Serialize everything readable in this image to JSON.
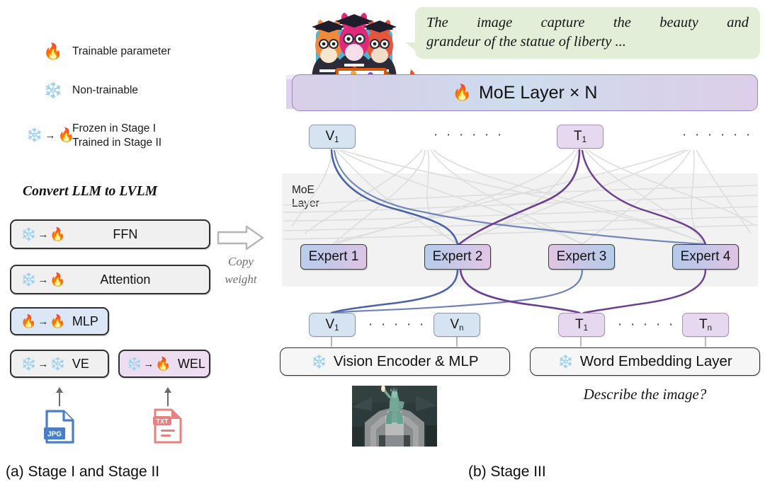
{
  "legend": {
    "items": [
      {
        "icon": "fire-icon",
        "glyph": "🔥",
        "label": "Trainable parameter",
        "type": "single"
      },
      {
        "icon": "snowflake-icon",
        "glyph": "❄️",
        "label": "Non-trainable",
        "type": "single"
      },
      {
        "icon": "snowflake-to-fire-icon",
        "glyph_from": "❄️",
        "arrow": "→",
        "glyph_to": "🔥",
        "label_line1": "Frozen in Stage I",
        "label_line2": "Trained in Stage II",
        "type": "dual"
      }
    ]
  },
  "left": {
    "title": "Convert LLM to LVLM",
    "boxes": [
      {
        "name": "ffn",
        "from": "❄️",
        "arrow": "→",
        "to": "🔥",
        "label": "FFN",
        "style": "gray",
        "wide": true
      },
      {
        "name": "attention",
        "from": "❄️",
        "arrow": "→",
        "to": "🔥",
        "label": "Attention",
        "style": "gray",
        "wide": true
      },
      {
        "name": "mlp",
        "from": "🔥",
        "arrow": "→",
        "to": "🔥",
        "label": "MLP",
        "style": "blue",
        "wide": false
      },
      {
        "name": "ve",
        "from": "❄️",
        "arrow": "→",
        "to": "❄️",
        "label": "VE",
        "style": "gray",
        "wide": false
      },
      {
        "name": "wel",
        "from": "❄️",
        "arrow": "→",
        "to": "🔥",
        "label": "WEL",
        "style": "purple",
        "wide": false
      }
    ],
    "copy_arrow": {
      "line1": "Copy",
      "line2": "weight"
    },
    "files": [
      {
        "name": "jpg-file-icon",
        "label": "JPG",
        "color": "#4a7ec7"
      },
      {
        "name": "txt-file-icon",
        "label": "TXT",
        "color": "#e8807f"
      }
    ]
  },
  "right": {
    "speech_bubble": {
      "line1": "The image capture the beauty and",
      "line2": "grandeur of the statue of liberty ..."
    },
    "moe_bar": {
      "icon": "🔥",
      "label": "MoE Layer × N"
    },
    "panel_label": {
      "line1": "MoE",
      "line2": "Layer"
    },
    "top_tokens": [
      {
        "name": "token-v1-top",
        "base": "V",
        "sub": "1",
        "color": "blue"
      },
      {
        "name": "ellipsis-1",
        "text": "· · · · · ·"
      },
      {
        "name": "token-t1-top",
        "base": "T",
        "sub": "1",
        "color": "purple"
      },
      {
        "name": "ellipsis-2",
        "text": "· · · · · ·"
      }
    ],
    "experts": [
      {
        "name": "expert-1",
        "label": "Expert 1"
      },
      {
        "name": "expert-2",
        "label": "Expert 2"
      },
      {
        "name": "expert-3",
        "label": "Expert 3"
      },
      {
        "name": "expert-4",
        "label": "Expert 4"
      }
    ],
    "bottom_tokens": [
      {
        "name": "token-v1",
        "base": "V",
        "sub": "1",
        "color": "blue"
      },
      {
        "name": "ellipsis-3",
        "text": "· · · · · ·"
      },
      {
        "name": "token-vn",
        "base": "V",
        "sub": "n",
        "color": "blue"
      },
      {
        "name": "token-t1",
        "base": "T",
        "sub": "1",
        "color": "purple"
      },
      {
        "name": "ellipsis-4",
        "text": "· · · · · ·"
      },
      {
        "name": "token-tn",
        "base": "T",
        "sub": "n",
        "color": "purple"
      }
    ],
    "encoders": [
      {
        "name": "vision-encoder-box",
        "icon": "❄️",
        "label": "Vision Encoder & MLP"
      },
      {
        "name": "word-embedding-box",
        "icon": "❄️",
        "label": "Word Embedding Layer"
      }
    ],
    "input_image_alt": "aerial photo of the Statue of Liberty",
    "prompt": "Describe the image?"
  },
  "captions": {
    "left": "(a) Stage I and Stage II",
    "right": "(b) Stage III"
  },
  "colors": {
    "fire": "#ef6c2a",
    "ice": "#4aaee8",
    "blue_token": "#d6e4f2",
    "purple_token": "#e6d8ee",
    "bubble_green": "#e3eed8",
    "panel_gray": "#f2f2f2",
    "route_blue": "#4a63a8",
    "route_purple": "#6b3e93",
    "route_faint": "#d8d8d8"
  }
}
